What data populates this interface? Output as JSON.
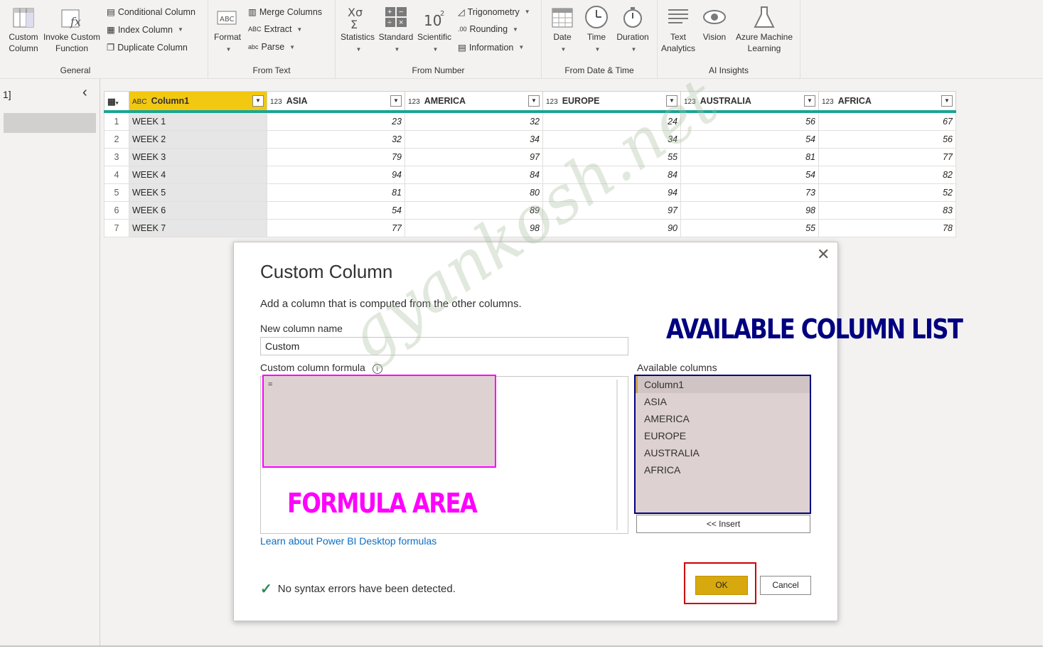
{
  "ribbon": {
    "general": {
      "label": "General",
      "custom_column_1": "Custom",
      "custom_column_2": "Column",
      "invoke_1": "Invoke Custom",
      "invoke_2": "Function",
      "conditional": "Conditional Column",
      "index": "Index Column",
      "duplicate": "Duplicate Column"
    },
    "text": {
      "label": "From Text",
      "format": "Format",
      "merge": "Merge Columns",
      "extract": "Extract",
      "parse": "Parse"
    },
    "number": {
      "label": "From Number",
      "statistics": "Statistics",
      "standard": "Standard",
      "scientific": "Scientific",
      "trig": "Trigonometry",
      "rounding": "Rounding",
      "information": "Information"
    },
    "datetime": {
      "label": "From Date & Time",
      "date": "Date",
      "time": "Time",
      "duration": "Duration"
    },
    "ai": {
      "label": "AI Insights",
      "text_1": "Text",
      "text_2": "Analytics",
      "vision": "Vision",
      "azure_1": "Azure Machine",
      "azure_2": "Learning"
    }
  },
  "left_pane": {
    "label": "1]"
  },
  "grid": {
    "headers": [
      "Column1",
      "ASIA",
      "AMERICA",
      "EUROPE",
      "AUSTRALIA",
      "AFRICA"
    ],
    "rows": [
      {
        "i": "1",
        "w": "WEEK 1",
        "v": [
          "23",
          "32",
          "24",
          "56",
          "67"
        ]
      },
      {
        "i": "2",
        "w": "WEEK 2",
        "v": [
          "32",
          "34",
          "34",
          "54",
          "56"
        ]
      },
      {
        "i": "3",
        "w": "WEEK 3",
        "v": [
          "79",
          "97",
          "55",
          "81",
          "77"
        ]
      },
      {
        "i": "4",
        "w": "WEEK 4",
        "v": [
          "94",
          "84",
          "84",
          "54",
          "82"
        ]
      },
      {
        "i": "5",
        "w": "WEEK 5",
        "v": [
          "81",
          "80",
          "94",
          "73",
          "52"
        ]
      },
      {
        "i": "6",
        "w": "WEEK 6",
        "v": [
          "54",
          "89",
          "97",
          "98",
          "83"
        ]
      },
      {
        "i": "7",
        "w": "WEEK 7",
        "v": [
          "77",
          "98",
          "90",
          "55",
          "78"
        ]
      }
    ]
  },
  "dialog": {
    "title": "Custom Column",
    "subtitle": "Add a column that is computed from the other columns.",
    "name_label": "New column name",
    "name_value": "Custom",
    "formula_label": "Custom column formula",
    "formula_value": "=",
    "available_label": "Available columns",
    "columns": [
      "Column1",
      "ASIA",
      "AMERICA",
      "EUROPE",
      "AUSTRALIA",
      "AFRICA"
    ],
    "insert": "<< Insert",
    "link": "Learn about Power BI Desktop formulas",
    "status": "No syntax errors have been detected.",
    "ok": "OK",
    "cancel": "Cancel"
  },
  "annotations": {
    "formula_area": "FORMULA AREA",
    "column_list": "AVAILABLE COLUMN LIST",
    "watermark": "gyankosh.net"
  }
}
